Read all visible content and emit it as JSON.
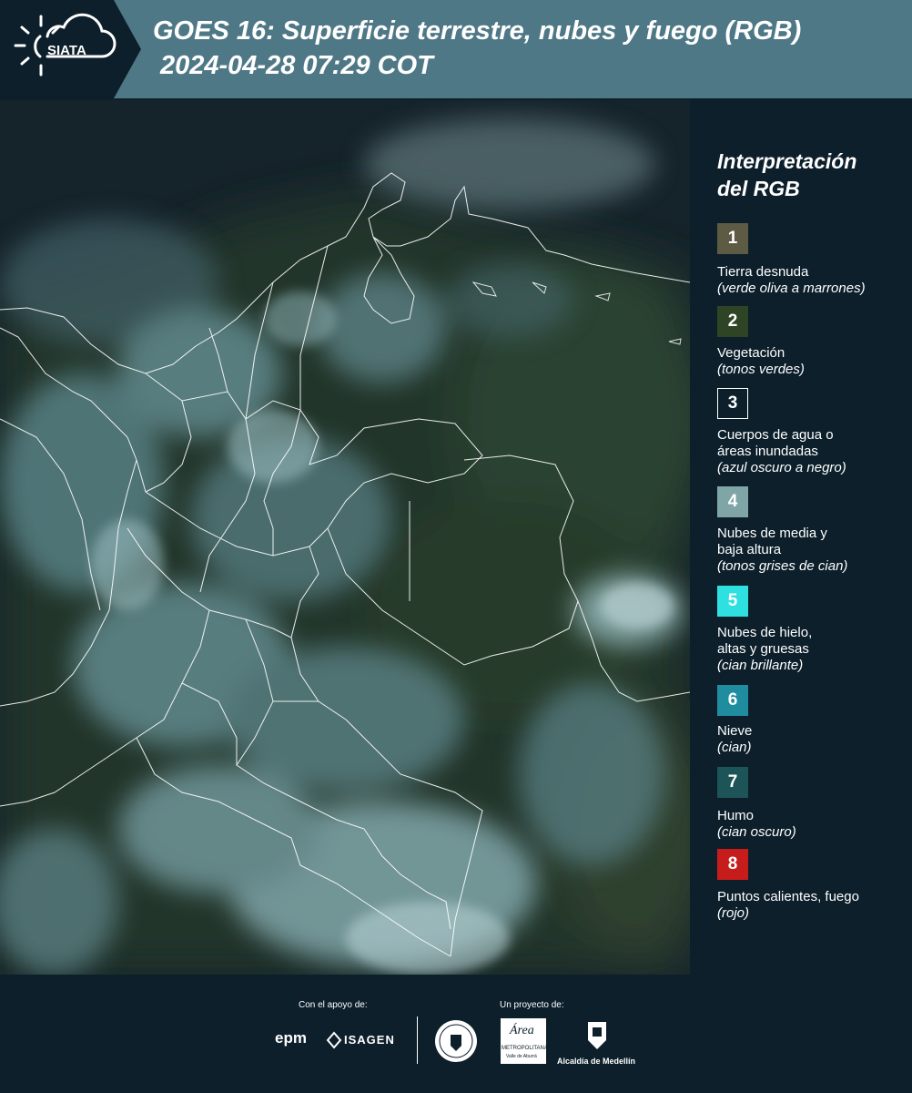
{
  "header": {
    "logo_text": "SIATA",
    "title_line1": "GOES 16: Superficie terrestre, nubes y fuego (RGB)",
    "title_line2": "2024-04-28 07:29 COT"
  },
  "legend": {
    "title_line1": "Interpretación",
    "title_line2": "del RGB",
    "items": [
      {
        "num": "1",
        "color": "#5d5b43",
        "name_lines": [
          "Tierra desnuda"
        ],
        "desc": "(verde oliva a marrones)"
      },
      {
        "num": "2",
        "color": "#2f4425",
        "name_lines": [
          "Vegetación"
        ],
        "desc": "(tonos verdes)"
      },
      {
        "num": "3",
        "color": "#0c1f2b",
        "name_lines": [
          "Cuerpos de agua o",
          "áreas inundadas"
        ],
        "desc": "(azul oscuro a negro)"
      },
      {
        "num": "4",
        "color": "#7fa5a6",
        "name_lines": [
          "Nubes de media y",
          "baja altura"
        ],
        "desc": "(tonos grises de cian)"
      },
      {
        "num": "5",
        "color": "#2ee0e0",
        "name_lines": [
          "Nubes de hielo,",
          "altas y gruesas"
        ],
        "desc": "(cian brillante)"
      },
      {
        "num": "6",
        "color": "#1f8ca0",
        "name_lines": [
          "Nieve"
        ],
        "desc": "(cian)"
      },
      {
        "num": "7",
        "color": "#1d5458",
        "name_lines": [
          "Humo"
        ],
        "desc": "(cian oscuro)"
      },
      {
        "num": "8",
        "color": "#c61c1c",
        "name_lines": [
          "Puntos calientes, fuego"
        ],
        "desc": "(rojo)"
      }
    ]
  },
  "footer": {
    "support_label": "Con el apoyo de:",
    "project_label": "Un proyecto de:",
    "epm_text": "epm",
    "isagen_text": "ISAGEN",
    "metropolitana_text": "METROPOLITANA",
    "metropolitana_sub": "Valle de Aburrá",
    "area_text": "Área",
    "alcaldia_text": "Alcaldía de Medellín"
  },
  "colors": {
    "header_bg": "#4f7886",
    "page_bg": "#0c1f2b",
    "ocean": "#162228",
    "vegetation": "#2a3f2b",
    "cloud": "#8fb7bd",
    "border_line": "#ffffff"
  }
}
